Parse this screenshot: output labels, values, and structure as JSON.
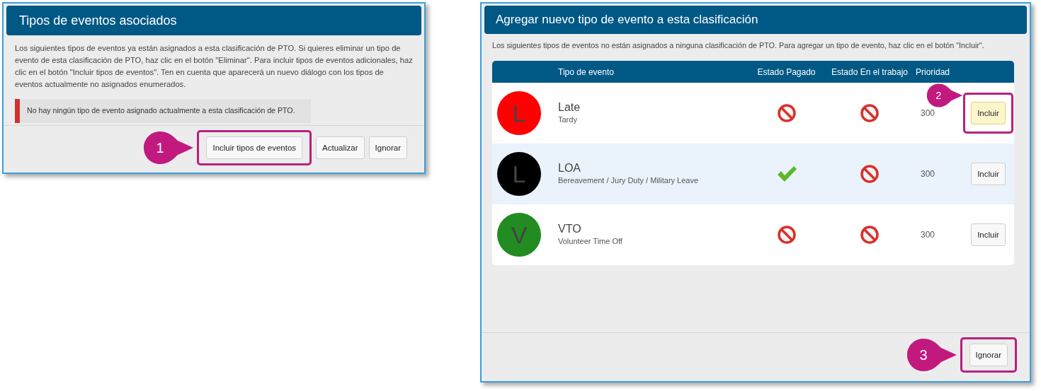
{
  "assigned_dialog": {
    "title": "Tipos de eventos asociados",
    "description": "Los siguientes tipos de eventos ya están asignados a esta clasificación de PTO. Si quieres eliminar un tipo de evento de esta clasificación de PTO, haz clic en el botón \"Eliminar\".  Para incluir tipos de eventos adicionales, haz clic en el botón \"Incluir tipos de eventos\". Ten en cuenta que aparecerá un nuevo diálogo con los tipos de eventos actualmente no asignados enumerados.",
    "alert": "No hay ningún tipo de evento asignado actualmente a esta clasificación de PTO.",
    "buttons": [
      {
        "label": "Incluir tipos de eventos",
        "callout": "1"
      },
      {
        "label": "Actualizar"
      },
      {
        "label": "Ignorar"
      }
    ]
  },
  "add_dialog": {
    "title": "Agregar nuevo tipo de evento a esta clasificación",
    "description": "Los siguientes tipos de eventos no están asignados a ninguna clasificación de PTO. Para agregar un tipo de evento, haz clic en el botón \"Incluir\".",
    "table": {
      "columns": [
        "Tipo de evento",
        "Estado Pagado",
        "Estado En el trabajo",
        "Prioridad"
      ],
      "rows": [
        {
          "initial": "L",
          "color": "#ff0000",
          "name": "Late",
          "subtitle": "Tardy",
          "paid": false,
          "on_the_job": false,
          "priority": "300",
          "selected": false,
          "button": {
            "label": "Incluir",
            "hovered": true,
            "callout": "2"
          }
        },
        {
          "initial": "L",
          "color": "#000000",
          "name": "LOA",
          "subtitle": "Bereavement / Jury Duty / Military Leave",
          "paid": true,
          "on_the_job": false,
          "priority": "300",
          "selected": true,
          "button": {
            "label": "Incluir",
            "hovered": false
          }
        },
        {
          "initial": "V",
          "color": "#228b22",
          "name": "VTO",
          "subtitle": "Volunteer Time Off",
          "paid": false,
          "on_the_job": false,
          "priority": "300",
          "selected": false,
          "button": {
            "label": "Incluir",
            "hovered": false
          }
        }
      ]
    },
    "buttons": [
      {
        "label": "Ignorar",
        "callout": "3"
      }
    ]
  }
}
